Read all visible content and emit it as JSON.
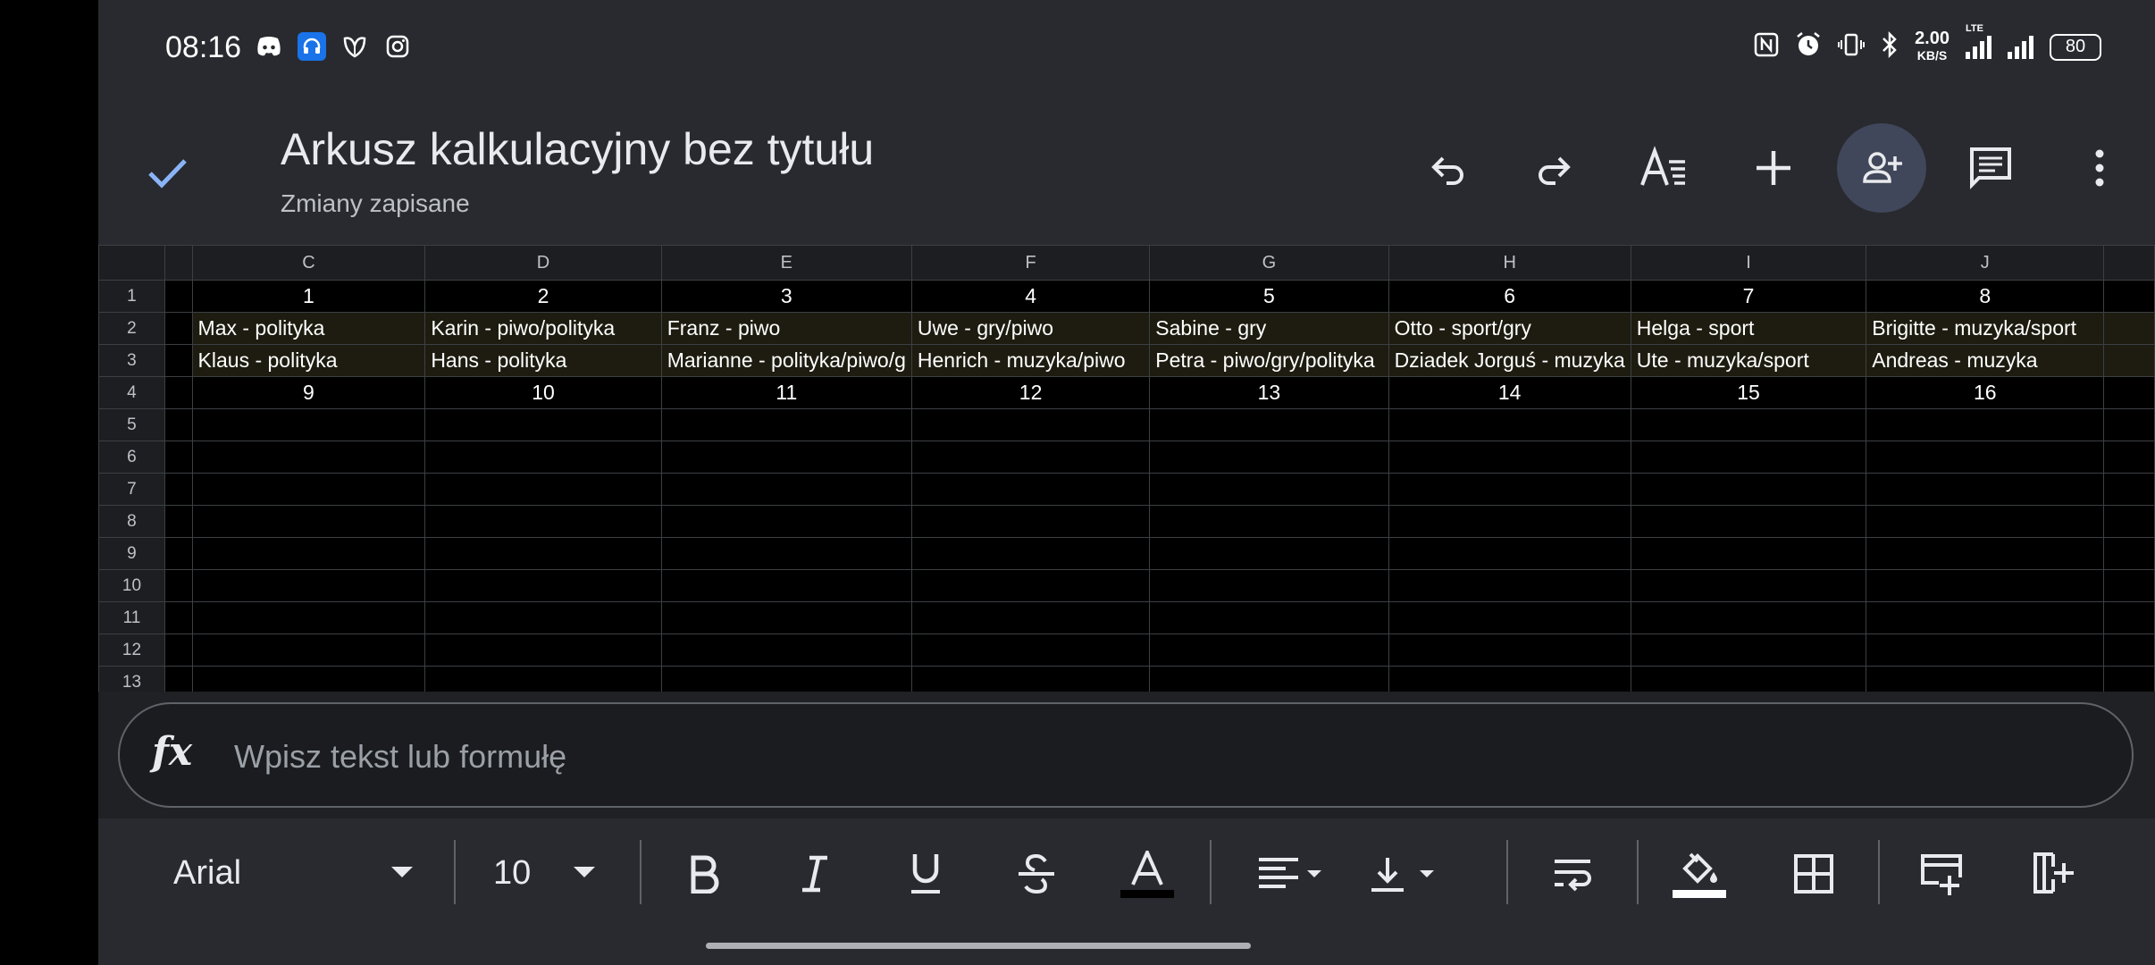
{
  "status_bar": {
    "time": "08:16",
    "data_rate_value": "2.00",
    "data_rate_unit": "KB/S",
    "network": "LTE",
    "battery": "80",
    "left_icons": [
      "discord-icon",
      "headset-app-icon",
      "vivino-icon",
      "instagram-icon"
    ],
    "right_icons": [
      "nfc-icon",
      "alarm-icon",
      "vibrate-icon",
      "bluetooth-icon",
      "signal-icon",
      "signal-icon",
      "battery-icon"
    ]
  },
  "header": {
    "title": "Arkusz kalkulacyjny bez tytułu",
    "subtitle": "Zmiany zapisane",
    "actions": [
      "undo-icon",
      "redo-icon",
      "text-format-icon",
      "add-icon",
      "share-person-add-icon",
      "comment-icon",
      "more-vert-icon"
    ]
  },
  "grid": {
    "columns": [
      "C",
      "D",
      "E",
      "F",
      "G",
      "H",
      "I",
      "J"
    ],
    "row_numbers": [
      "1",
      "2",
      "3",
      "4",
      "5",
      "6",
      "7",
      "8",
      "9",
      "10",
      "11",
      "12",
      "13"
    ],
    "rows": [
      [
        "1",
        "2",
        "3",
        "4",
        "5",
        "6",
        "7",
        "8"
      ],
      [
        "Max - polityka",
        "Karin - piwo/polityka",
        "Franz - piwo",
        "Uwe - gry/piwo",
        "Sabine - gry",
        "Otto - sport/gry",
        "Helga - sport",
        "Brigitte - muzyka/sport"
      ],
      [
        "Klaus - polityka",
        "Hans - polityka",
        "Marianne - polityka/piwo/g",
        "Henrich - muzyka/piwo",
        "Petra - piwo/gry/polityka",
        "Dziadek Jorguś - muzyka",
        "Ute - muzyka/sport",
        "Andreas - muzyka"
      ],
      [
        "9",
        "10",
        "11",
        "12",
        "13",
        "14",
        "15",
        "16"
      ]
    ]
  },
  "formula_bar": {
    "fx_label": "fx",
    "placeholder": "Wpisz tekst lub formułę"
  },
  "toolbar": {
    "font": "Arial",
    "font_size": "10",
    "text_color_bar": "#000000",
    "fill_color_bar": "#ffffff"
  },
  "colors": {
    "accent": "#8ab4f8",
    "share_bg": "#41475a",
    "selected_column": "#2c4a85",
    "highlight_rows": "#1e1c10"
  }
}
